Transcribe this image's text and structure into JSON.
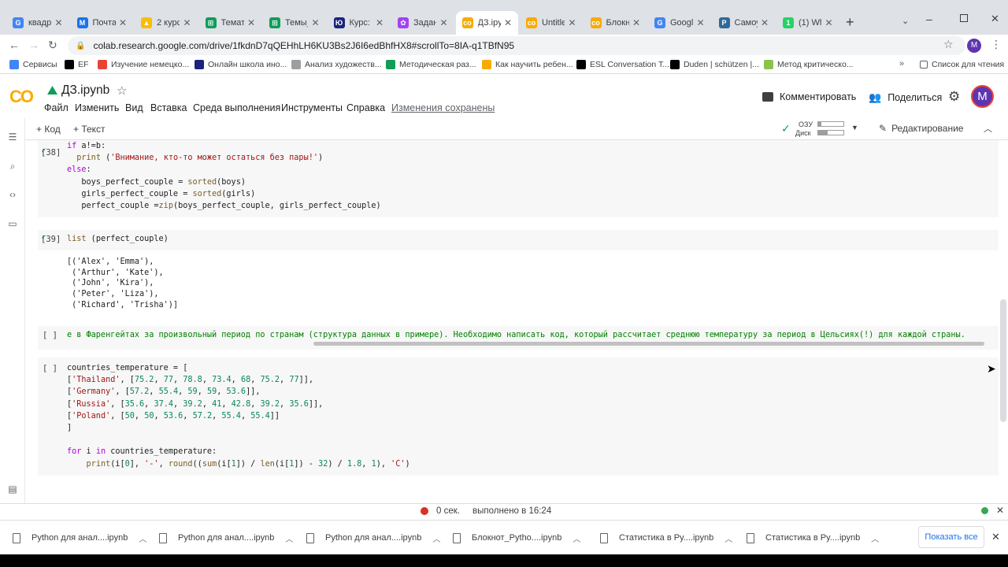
{
  "tabs": [
    {
      "title": "квадр",
      "fav": "G",
      "color": "#4285f4"
    },
    {
      "title": "Почта",
      "fav": "M",
      "color": "#1a73e8"
    },
    {
      "title": "2 курс",
      "fav": "▲",
      "color": "#fbbc04"
    },
    {
      "title": "Темати",
      "fav": "⊞",
      "color": "#0f9d58"
    },
    {
      "title": "Темы_",
      "fav": "⊞",
      "color": "#0f9d58"
    },
    {
      "title": "Курс: К",
      "fav": "Ю",
      "color": "#1a237e"
    },
    {
      "title": "Задани",
      "fav": "✿",
      "color": "#a142f4"
    },
    {
      "title": "ДЗ.ipy",
      "fav": "co",
      "color": "#f9ab00"
    },
    {
      "title": "Untitle",
      "fav": "co",
      "color": "#f9ab00"
    },
    {
      "title": "Блокн",
      "fav": "co",
      "color": "#f9ab00"
    },
    {
      "title": "Google",
      "fav": "G",
      "color": "#4285f4"
    },
    {
      "title": "Самоу",
      "fav": "P",
      "color": "#306998"
    },
    {
      "title": "(1) Wh",
      "fav": "1",
      "color": "#25d366"
    }
  ],
  "url": "colab.research.google.com/drive/1fkdnD7qQEHhLH6KU3Bs2J6I6edBhfHX8#scrollTo=8IA-q1TBfN95",
  "profile_initial": "M",
  "bookmarks": [
    {
      "label": "Сервисы",
      "color": "#4285f4"
    },
    {
      "label": "EF",
      "color": "#000000"
    },
    {
      "label": "Изучение немецко...",
      "color": "#ea4335"
    },
    {
      "label": "Онлайн школа ино...",
      "color": "#1a237e"
    },
    {
      "label": "Анализ художеств...",
      "color": "#9e9e9e"
    },
    {
      "label": "Методическая раз...",
      "color": "#0f9d58"
    },
    {
      "label": "Как научить ребен...",
      "color": "#f9ab00"
    },
    {
      "label": "ESL Conversation T...",
      "color": "#000000"
    },
    {
      "label": "Duden | schützen |...",
      "color": "#000000"
    },
    {
      "label": "Метод критическо...",
      "color": "#8bc34a"
    }
  ],
  "reading_list": "Список для чтения",
  "notebook": {
    "title": "ДЗ.ipynb",
    "menu": [
      "Файл",
      "Изменить",
      "Вид",
      "Вставка",
      "Среда выполнения",
      "Инструменты",
      "Справка"
    ],
    "saved_status": "Изменения сохранены",
    "comment_label": "Комментировать",
    "share_label": "Поделиться",
    "avatar": "M"
  },
  "toolbar": {
    "add_code": "+ Код",
    "add_text": "+ Текст",
    "ram_label": "ОЗУ",
    "disk_label": "Диск",
    "edit_label": "Редактирование"
  },
  "cells": {
    "c38": {
      "prompt": "[38]"
    },
    "c39": {
      "prompt": "[39]",
      "code": "list (perfect_couple)"
    },
    "c39_output": [
      "[('Alex', 'Emma'),",
      " ('Arthur', 'Kate'),",
      " ('John', 'Kira'),",
      " ('Peter', 'Liza'),",
      " ('Richard', 'Trisha')]"
    ],
    "c_text": {
      "prompt": "[ ]",
      "code": "е в Фаренгейтах за произвольный период по странам (структура данных в примере). Необходимо написать код, который рассчитает среднюю температуру за период в Цельсиях(!) для каждой страны."
    },
    "c_temp": {
      "prompt": "[ ]"
    }
  },
  "status": {
    "time": "0 сек.",
    "completed": "выполнено в 16:24"
  },
  "downloads": [
    "Python для анал....ipynb",
    "Python для анал....ipynb",
    "Python для анал....ipynb",
    "Блокнот_Pytho....ipynb",
    "Статистика в Py....ipynb",
    "Статистика в Py....ipynb"
  ],
  "show_all": "Показать все"
}
